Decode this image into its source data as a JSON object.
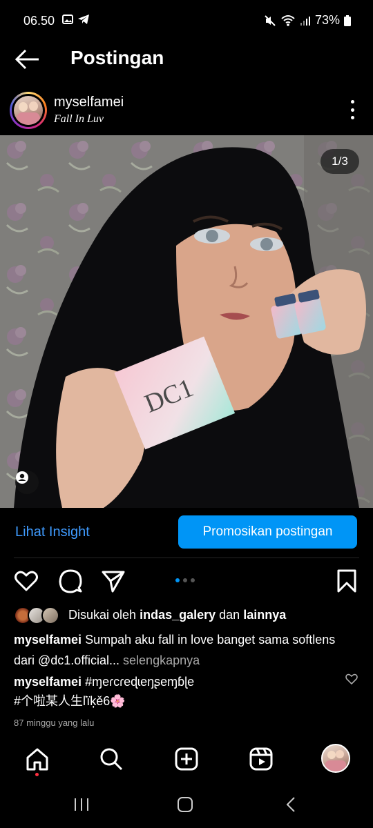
{
  "status_bar": {
    "time": "06.50",
    "battery": "73%",
    "icons": [
      "image-icon",
      "telegram-icon",
      "mute-icon",
      "wifi-icon",
      "signal-icon",
      "battery-icon"
    ]
  },
  "app_bar": {
    "title": "Postingan"
  },
  "post": {
    "username": "myselfamei",
    "song": "Fall In Luv",
    "counter": "1/3",
    "photo_alt_text": "DC1"
  },
  "insight": {
    "link_label": "Lihat Insight",
    "promote_label": "Promosikan postingan"
  },
  "likes": {
    "prefix": "Disukai oleh",
    "user": "indas_galery",
    "connector": "dan",
    "others": "lainnya"
  },
  "caption": {
    "username": "myselfamei",
    "text": "Sumpah aku fall in love banget sama softlens dari @dc1.official...",
    "more": "selengkapnya"
  },
  "comment": {
    "username": "myselfamei",
    "text": "#ɱeɾcɾeɖɩeŋʂeɱɓɭe",
    "line2": "#个啦某人生ľïķě6🌸"
  },
  "timestamp": "87 minggu yang lalu",
  "carousel": {
    "total": 3,
    "active": 1
  },
  "colors": {
    "accent": "#0095f6",
    "link": "#3f9bff",
    "muted": "#a8a8a8",
    "background": "#000000"
  }
}
